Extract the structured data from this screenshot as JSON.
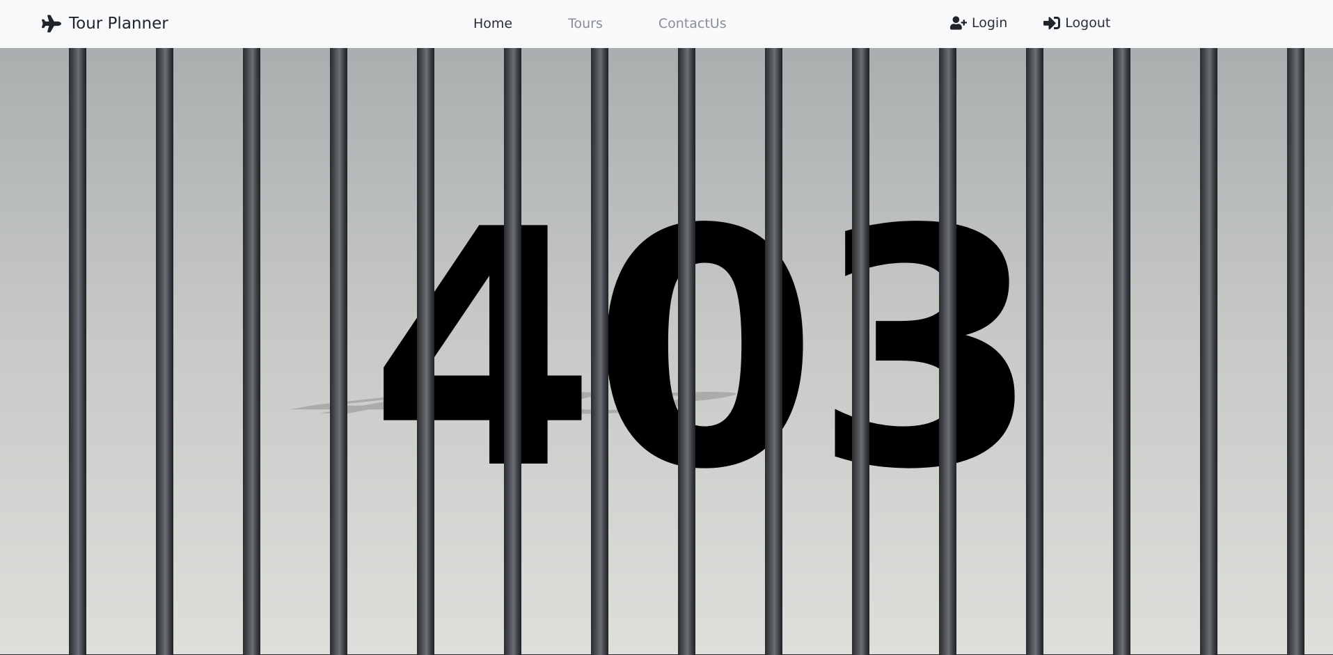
{
  "navbar": {
    "brand": {
      "label": "Tour Planner",
      "icon": "plane-icon"
    },
    "links": [
      {
        "label": "Home",
        "active": true
      },
      {
        "label": "Tours",
        "active": false
      },
      {
        "label": "ContactUs",
        "active": false
      }
    ],
    "auth": {
      "login": {
        "label": "Login",
        "icon": "user-plus-icon"
      },
      "logout": {
        "label": "Logout",
        "icon": "sign-in-icon"
      }
    }
  },
  "error": {
    "code": "403",
    "shadow_code": "403"
  },
  "colors": {
    "navbar_bg": "#f8f9fb",
    "background_top": "#a9aeaf",
    "background_bottom": "#dedfdb",
    "bar_dark": "#2a2c2f",
    "bar_light": "#6c7075",
    "text_active": "#2b2f33",
    "text_muted": "#8a8d91"
  },
  "bars": {
    "count": 15
  }
}
